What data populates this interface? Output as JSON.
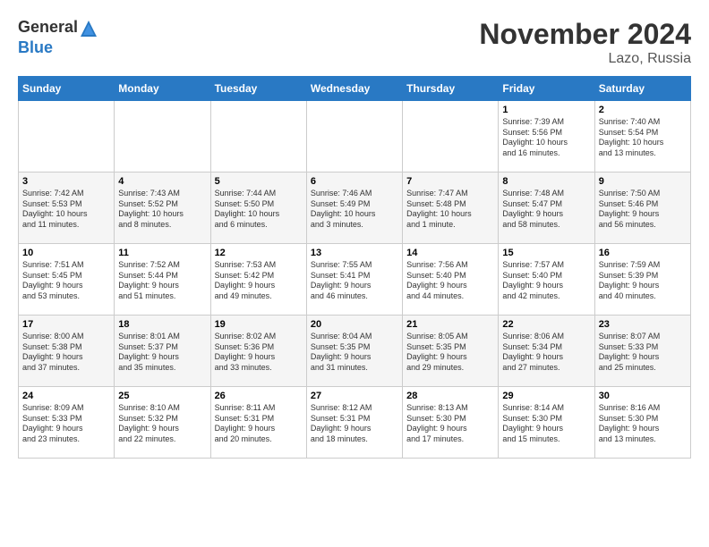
{
  "header": {
    "logo_general": "General",
    "logo_blue": "Blue",
    "month": "November 2024",
    "location": "Lazo, Russia"
  },
  "weekdays": [
    "Sunday",
    "Monday",
    "Tuesday",
    "Wednesday",
    "Thursday",
    "Friday",
    "Saturday"
  ],
  "weeks": [
    [
      {
        "day": "",
        "info": ""
      },
      {
        "day": "",
        "info": ""
      },
      {
        "day": "",
        "info": ""
      },
      {
        "day": "",
        "info": ""
      },
      {
        "day": "",
        "info": ""
      },
      {
        "day": "1",
        "info": "Sunrise: 7:39 AM\nSunset: 5:56 PM\nDaylight: 10 hours\nand 16 minutes."
      },
      {
        "day": "2",
        "info": "Sunrise: 7:40 AM\nSunset: 5:54 PM\nDaylight: 10 hours\nand 13 minutes."
      }
    ],
    [
      {
        "day": "3",
        "info": "Sunrise: 7:42 AM\nSunset: 5:53 PM\nDaylight: 10 hours\nand 11 minutes."
      },
      {
        "day": "4",
        "info": "Sunrise: 7:43 AM\nSunset: 5:52 PM\nDaylight: 10 hours\nand 8 minutes."
      },
      {
        "day": "5",
        "info": "Sunrise: 7:44 AM\nSunset: 5:50 PM\nDaylight: 10 hours\nand 6 minutes."
      },
      {
        "day": "6",
        "info": "Sunrise: 7:46 AM\nSunset: 5:49 PM\nDaylight: 10 hours\nand 3 minutes."
      },
      {
        "day": "7",
        "info": "Sunrise: 7:47 AM\nSunset: 5:48 PM\nDaylight: 10 hours\nand 1 minute."
      },
      {
        "day": "8",
        "info": "Sunrise: 7:48 AM\nSunset: 5:47 PM\nDaylight: 9 hours\nand 58 minutes."
      },
      {
        "day": "9",
        "info": "Sunrise: 7:50 AM\nSunset: 5:46 PM\nDaylight: 9 hours\nand 56 minutes."
      }
    ],
    [
      {
        "day": "10",
        "info": "Sunrise: 7:51 AM\nSunset: 5:45 PM\nDaylight: 9 hours\nand 53 minutes."
      },
      {
        "day": "11",
        "info": "Sunrise: 7:52 AM\nSunset: 5:44 PM\nDaylight: 9 hours\nand 51 minutes."
      },
      {
        "day": "12",
        "info": "Sunrise: 7:53 AM\nSunset: 5:42 PM\nDaylight: 9 hours\nand 49 minutes."
      },
      {
        "day": "13",
        "info": "Sunrise: 7:55 AM\nSunset: 5:41 PM\nDaylight: 9 hours\nand 46 minutes."
      },
      {
        "day": "14",
        "info": "Sunrise: 7:56 AM\nSunset: 5:40 PM\nDaylight: 9 hours\nand 44 minutes."
      },
      {
        "day": "15",
        "info": "Sunrise: 7:57 AM\nSunset: 5:40 PM\nDaylight: 9 hours\nand 42 minutes."
      },
      {
        "day": "16",
        "info": "Sunrise: 7:59 AM\nSunset: 5:39 PM\nDaylight: 9 hours\nand 40 minutes."
      }
    ],
    [
      {
        "day": "17",
        "info": "Sunrise: 8:00 AM\nSunset: 5:38 PM\nDaylight: 9 hours\nand 37 minutes."
      },
      {
        "day": "18",
        "info": "Sunrise: 8:01 AM\nSunset: 5:37 PM\nDaylight: 9 hours\nand 35 minutes."
      },
      {
        "day": "19",
        "info": "Sunrise: 8:02 AM\nSunset: 5:36 PM\nDaylight: 9 hours\nand 33 minutes."
      },
      {
        "day": "20",
        "info": "Sunrise: 8:04 AM\nSunset: 5:35 PM\nDaylight: 9 hours\nand 31 minutes."
      },
      {
        "day": "21",
        "info": "Sunrise: 8:05 AM\nSunset: 5:35 PM\nDaylight: 9 hours\nand 29 minutes."
      },
      {
        "day": "22",
        "info": "Sunrise: 8:06 AM\nSunset: 5:34 PM\nDaylight: 9 hours\nand 27 minutes."
      },
      {
        "day": "23",
        "info": "Sunrise: 8:07 AM\nSunset: 5:33 PM\nDaylight: 9 hours\nand 25 minutes."
      }
    ],
    [
      {
        "day": "24",
        "info": "Sunrise: 8:09 AM\nSunset: 5:33 PM\nDaylight: 9 hours\nand 23 minutes."
      },
      {
        "day": "25",
        "info": "Sunrise: 8:10 AM\nSunset: 5:32 PM\nDaylight: 9 hours\nand 22 minutes."
      },
      {
        "day": "26",
        "info": "Sunrise: 8:11 AM\nSunset: 5:31 PM\nDaylight: 9 hours\nand 20 minutes."
      },
      {
        "day": "27",
        "info": "Sunrise: 8:12 AM\nSunset: 5:31 PM\nDaylight: 9 hours\nand 18 minutes."
      },
      {
        "day": "28",
        "info": "Sunrise: 8:13 AM\nSunset: 5:30 PM\nDaylight: 9 hours\nand 17 minutes."
      },
      {
        "day": "29",
        "info": "Sunrise: 8:14 AM\nSunset: 5:30 PM\nDaylight: 9 hours\nand 15 minutes."
      },
      {
        "day": "30",
        "info": "Sunrise: 8:16 AM\nSunset: 5:30 PM\nDaylight: 9 hours\nand 13 minutes."
      }
    ]
  ]
}
